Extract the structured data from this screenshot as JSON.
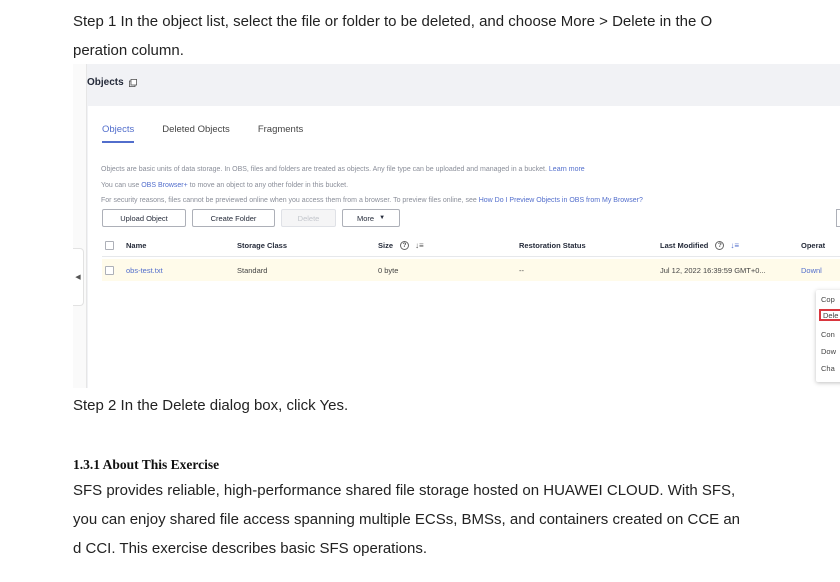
{
  "doc": {
    "step1_line1": "Step 1 In the object list, select the file or folder to be deleted, and choose More > Delete in the O",
    "step1_line2": "peration column.",
    "step2": "Step 2 In the Delete dialog box, click Yes.",
    "section_heading": "1.3.1 About This Exercise",
    "para_line1": "SFS provides reliable, high-performance shared file storage hosted on HUAWEI CLOUD. With SFS,",
    "para_line2": "you can enjoy shared file access spanning multiple ECSs, BMSs, and containers created on CCE an",
    "para_line3": "d CCI. This exercise describes basic SFS operations."
  },
  "screenshot": {
    "page_title": "Objects",
    "tabs": [
      "Objects",
      "Deleted Objects",
      "Fragments"
    ],
    "active_tab": "Objects",
    "info_line1": "Objects are basic units of data storage. In OBS, files and folders are treated as objects. Any file type can be uploaded and managed in a bucket.",
    "info_line1_link": "Learn more",
    "info_line2_prefix": "You can use",
    "info_line2_link": "OBS Browser+",
    "info_line2_suffix": "to move an object to any other folder in this bucket.",
    "info_line3_prefix": "For security reasons, files cannot be previewed online when you access them from a browser. To preview files online, see",
    "info_line3_link": "How Do I Preview Objects in OBS from My Browser?",
    "buttons": {
      "upload": "Upload Object",
      "create_folder": "Create Folder",
      "delete": "Delete",
      "more": "More"
    },
    "columns": {
      "name": "Name",
      "storage_class": "Storage Class",
      "size": "Size",
      "restoration_status": "Restoration Status",
      "last_modified": "Last Modified",
      "operation": "Operat"
    },
    "row": {
      "name": "obs-test.txt",
      "storage_class": "Standard",
      "size": "0 byte",
      "restoration_status": "--",
      "last_modified": "Jul 12, 2022 16:39:59 GMT+0...",
      "operation": "Downl"
    },
    "more_menu": [
      "Cop",
      "Dele",
      "Con",
      "Dow",
      "Cha"
    ],
    "highlighted_menu_item": "Dele",
    "colors": {
      "accent": "#526ecc",
      "highlight_border": "#d9363e",
      "row_highlight": "#fffbea"
    }
  }
}
